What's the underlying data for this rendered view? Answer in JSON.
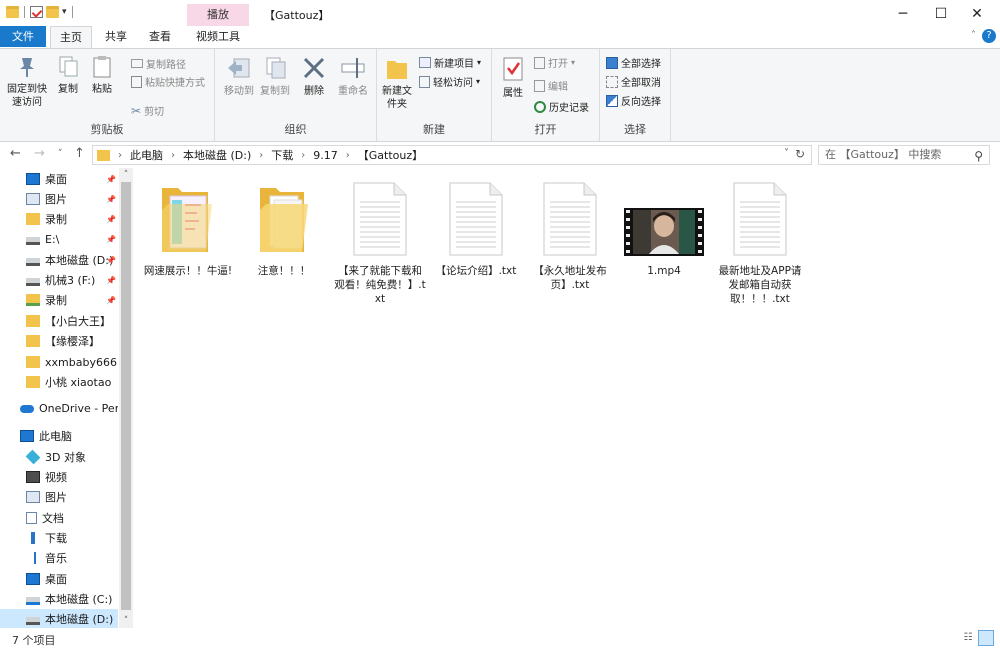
{
  "titlebar": {
    "context_tab": "播放",
    "window_title": "【Gattouz】",
    "minimize": "─",
    "maximize": "☐",
    "close": "✕"
  },
  "tabs": {
    "file": "文件",
    "items": [
      "主页",
      "共享",
      "查看",
      "视频工具"
    ]
  },
  "ribbon": {
    "clipboard": {
      "pin": "固定到快速访问",
      "copy": "复制",
      "paste": "粘贴",
      "copy_path": "复制路径",
      "paste_shortcut": "粘贴快捷方式",
      "cut": "剪切",
      "label": "剪贴板"
    },
    "organize": {
      "move_to": "移动到",
      "copy_to": "复制到",
      "delete": "删除",
      "rename": "重命名",
      "label": "组织"
    },
    "new": {
      "new_folder": "新建文件夹",
      "new_item": "新建项目",
      "easy_access": "轻松访问",
      "label": "新建"
    },
    "open": {
      "properties": "属性",
      "open": "打开",
      "edit": "编辑",
      "history": "历史记录",
      "label": "打开"
    },
    "select": {
      "select_all": "全部选择",
      "select_none": "全部取消",
      "invert": "反向选择",
      "label": "选择"
    }
  },
  "address": {
    "crumbs": [
      "此电脑",
      "本地磁盘 (D:)",
      "下载",
      "9.17",
      "【Gattouz】"
    ],
    "search_placeholder": "在 【Gattouz】 中搜索"
  },
  "sidebar": {
    "items": [
      {
        "label": "桌面",
        "pinned": true
      },
      {
        "label": "图片",
        "pinned": true
      },
      {
        "label": "录制",
        "pinned": true
      },
      {
        "label": "E:\\",
        "pinned": true
      },
      {
        "label": "本地磁盘 (D:)",
        "pinned": true
      },
      {
        "label": "机械3 (F:)",
        "pinned": true
      },
      {
        "label": "录制",
        "pinned": true
      },
      {
        "label": "【小白大王】",
        "pinned": false
      },
      {
        "label": "【缘樱泽】",
        "pinned": false
      },
      {
        "label": "xxmbaby666",
        "pinned": false
      },
      {
        "label": "小桃 xiaotao",
        "pinned": false
      },
      {
        "label": "OneDrive - Perso",
        "pinned": false
      },
      {
        "label": "此电脑",
        "pinned": false
      },
      {
        "label": "3D 对象",
        "pinned": false
      },
      {
        "label": "视频",
        "pinned": false
      },
      {
        "label": "图片",
        "pinned": false
      },
      {
        "label": "文档",
        "pinned": false
      },
      {
        "label": "下载",
        "pinned": false
      },
      {
        "label": "音乐",
        "pinned": false
      },
      {
        "label": "桌面",
        "pinned": false
      },
      {
        "label": "本地磁盘 (C:)",
        "pinned": false
      },
      {
        "label": "本地磁盘 (D:)",
        "pinned": false
      }
    ]
  },
  "files": [
    {
      "name": "网速展示！！牛逼!",
      "type": "folder-preview"
    },
    {
      "name": "注意！！！",
      "type": "folder"
    },
    {
      "name": "【来了就能下载和观看！纯免费！】.txt",
      "type": "txt"
    },
    {
      "name": "【论坛介绍】.txt",
      "type": "txt"
    },
    {
      "name": "【永久地址发布页】.txt",
      "type": "txt"
    },
    {
      "name": "1.mp4",
      "type": "video"
    },
    {
      "name": "最新地址及APP请发邮箱自动获取！！！.txt",
      "type": "txt"
    }
  ],
  "status": {
    "count": "7 个项目"
  },
  "colors": {
    "accent": "#1979ca",
    "folder": "#f3c44c",
    "context_tab": "#f8d7e7",
    "selection": "#cce8ff"
  }
}
